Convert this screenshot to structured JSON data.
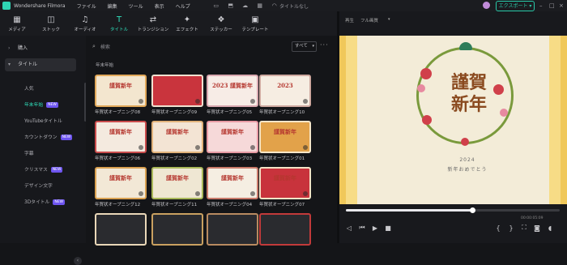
{
  "app": {
    "name": "Wondershare Filmora",
    "doc_title": "タイトルなし"
  },
  "menu": [
    "ファイル",
    "編集",
    "ツール",
    "表示",
    "ヘルプ"
  ],
  "title_icons": [
    "monitor-icon",
    "save-icon",
    "cloud-icon",
    "grid-icon",
    "headset-icon"
  ],
  "export_label": "エクスポート",
  "toolbar": [
    {
      "icon": "▦",
      "label": "メディア",
      "name": "media"
    },
    {
      "icon": "◫",
      "label": "ストック",
      "name": "stock"
    },
    {
      "icon": "♫",
      "label": "オーディオ",
      "name": "audio"
    },
    {
      "icon": "T",
      "label": "タイトル",
      "name": "titles",
      "active": true
    },
    {
      "icon": "⇄",
      "label": "トランジション",
      "name": "transitions"
    },
    {
      "icon": "✦",
      "label": "エフェクト",
      "name": "effects"
    },
    {
      "icon": "❖",
      "label": "ステッカー",
      "name": "stickers"
    },
    {
      "icon": "▣",
      "label": "テンプレート",
      "name": "templates"
    }
  ],
  "sidebar": {
    "top_item": "購入",
    "selected_item": "タイトル",
    "subitems": [
      {
        "label": "人気"
      },
      {
        "label": "年末年始",
        "badge": "NEW",
        "active": true
      },
      {
        "label": "YouTubeタイトル"
      },
      {
        "label": "カウントダウン",
        "badge": "NEW"
      },
      {
        "label": "字幕"
      },
      {
        "label": "クリスマス",
        "badge": "NEW"
      },
      {
        "label": "デザイン文字"
      },
      {
        "label": "3Dタイトル",
        "badge": "NEW"
      }
    ]
  },
  "library": {
    "search_placeholder": "検索",
    "filter_label": "すべて",
    "section_title": "年末年始",
    "cards": [
      {
        "label": "年賀状オープニング08",
        "text": "謹賀新年",
        "bg": "#f3e6cf",
        "accent": "#e1a85a"
      },
      {
        "label": "年賀状オープニング09",
        "text": "",
        "bg": "#c9343d",
        "accent": "#f0e0d0"
      },
      {
        "label": "年賀状オープニング05",
        "text": "2023 謹賀新年",
        "bg": "#f7ece6",
        "accent": "#d9a8b0"
      },
      {
        "label": "年賀状オープニング10",
        "text": "2023",
        "bg": "#f6ede2",
        "accent": "#cfa9a0"
      },
      {
        "label": "年賀状オープニング06",
        "text": "謹賀新年",
        "bg": "#f4eadf",
        "accent": "#c94c4c"
      },
      {
        "label": "年賀状オープニング02",
        "text": "謹賀新年",
        "bg": "#f3e4d4",
        "accent": "#e1b27a"
      },
      {
        "label": "年賀状オープニング03",
        "text": "謹賀新年",
        "bg": "#f6d9d9",
        "accent": "#e79aa3"
      },
      {
        "label": "年賀状オープニング01",
        "text": "謹賀新年",
        "bg": "#e2a24a",
        "accent": "#f6e6c8"
      },
      {
        "label": "年賀状オープニング12",
        "text": "謹賀新年",
        "bg": "#f2e8d6",
        "accent": "#d9a050"
      },
      {
        "label": "年賀状オープニング11",
        "text": "謹賀新年",
        "bg": "#efe7d3",
        "accent": "#a9b85a"
      },
      {
        "label": "年賀状オープニング04",
        "text": "謹賀新年",
        "bg": "#f5eee2",
        "accent": "#c97a6a"
      },
      {
        "label": "年賀状オープニング07",
        "text": "謹賀新年",
        "bg": "#c8333c",
        "accent": "#f3e4c6"
      },
      {
        "label": "",
        "text": "",
        "bg": "#2a2b2f",
        "accent": "#e9d7b8"
      },
      {
        "label": "",
        "text": "",
        "bg": "#2a2b2f",
        "accent": "#c9a060"
      },
      {
        "label": "",
        "text": "",
        "bg": "#2a2b2f",
        "accent": "#b88a60"
      },
      {
        "label": "",
        "text": "",
        "bg": "#2a2b2f",
        "accent": "#c23a3a"
      }
    ]
  },
  "preview": {
    "player_label": "再生",
    "quality_label": "フル画質",
    "canvas_text": "謹賀\n新年",
    "year": "2024",
    "greeting": "新年おめでとう",
    "timecode": "00:00:05:09",
    "progress": 0.59
  },
  "colors": {
    "accent": "#2fe0bb",
    "badge": "#6e55f0"
  }
}
